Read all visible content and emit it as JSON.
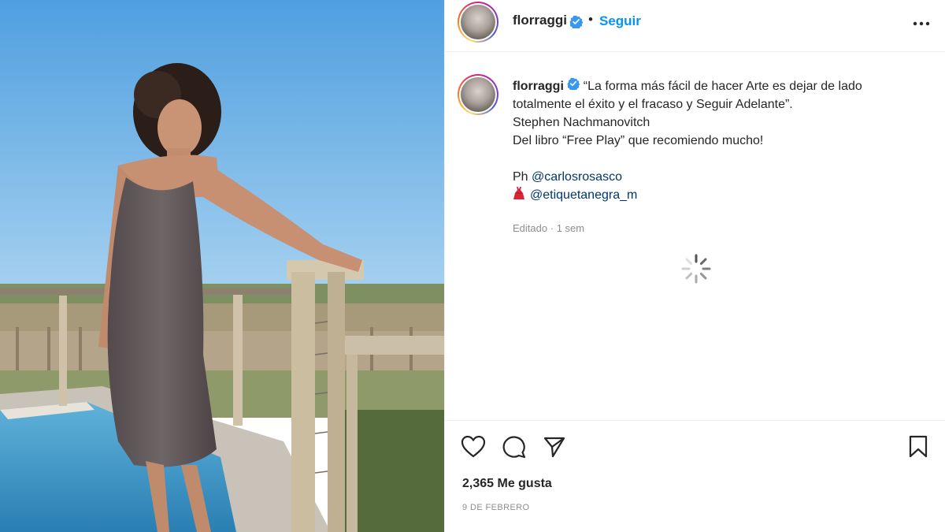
{
  "post": {
    "username": "florraggi",
    "verified": true,
    "follow_label": "Seguir",
    "separator": "•",
    "more_icon": "more-options-icon"
  },
  "caption": {
    "line1": "“La forma más fácil de hacer Arte es dejar de lado",
    "line2": "totalmente el éxito y el fracaso y Seguir Adelante”.",
    "line3": "Stephen Nachmanovitch",
    "line4": "Del libro “Free Play” que recomiendo mucho!",
    "credit_prefix": "Ph ",
    "photographer": "@carlosrosasco",
    "dress_emoji_icon": "red-dress-icon",
    "brand": "@etiquetanegra_m"
  },
  "meta": {
    "edited": "Editado",
    "dot": "·",
    "age": "1 sem"
  },
  "actions": {
    "like_icon": "heart-icon",
    "comment_icon": "comment-icon",
    "share_icon": "share-icon",
    "save_icon": "bookmark-icon",
    "likes": "2,365 Me gusta",
    "date": "9 DE FEBRERO"
  },
  "colors": {
    "link": "#0095f6",
    "mention": "#00376b",
    "muted": "#8e8e8e",
    "text": "#262626"
  }
}
